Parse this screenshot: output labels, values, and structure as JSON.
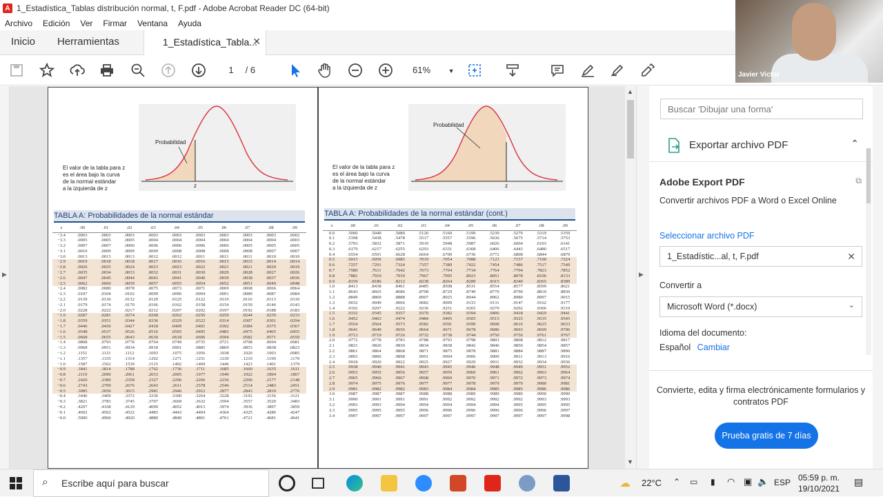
{
  "window": {
    "title": "1_Estadística_Tablas distribución normal, t, F.pdf - Adobe Acrobat Reader DC (64-bit)"
  },
  "menu": [
    "Archivo",
    "Edición",
    "Ver",
    "Firmar",
    "Ventana",
    "Ayuda"
  ],
  "tabs": {
    "home": "Inicio",
    "tools": "Herramientas",
    "document": "1_Estadística_Tabla..."
  },
  "toolbar": {
    "page_current": "1",
    "page_total": "/ 6",
    "zoom": "61%"
  },
  "pdf": {
    "left": {
      "fig_label": "Probabilidad",
      "caption": [
        "El valor de la tabla para z",
        "es el área bajo la curva",
        "de la normal estándar",
        "a la izquierda de z"
      ],
      "axis_mark": "z",
      "table_title": "TABLA  A:  Probabilidades de la normal estándar",
      "col_z": "z",
      "cols": [
        ".00",
        ".01",
        ".02",
        ".03",
        ".04",
        ".05",
        ".06",
        ".07",
        ".08",
        ".09"
      ],
      "rows": [
        [
          "−3.4",
          ".0003",
          ".0003",
          ".0003",
          ".0003",
          ".0003",
          ".0003",
          ".0003",
          ".0003",
          ".0003",
          ".0002"
        ],
        [
          "−3.3",
          ".0005",
          ".0005",
          ".0005",
          ".0004",
          ".0004",
          ".0004",
          ".0004",
          ".0004",
          ".0004",
          ".0003"
        ],
        [
          "−3.2",
          ".0007",
          ".0007",
          ".0006",
          ".0006",
          ".0006",
          ".0006",
          ".0006",
          ".0005",
          ".0005",
          ".0005"
        ],
        [
          "−3.1",
          ".0010",
          ".0009",
          ".0009",
          ".0009",
          ".0008",
          ".0008",
          ".0008",
          ".0008",
          ".0007",
          ".0007"
        ],
        [
          "−3.0",
          ".0013",
          ".0013",
          ".0013",
          ".0012",
          ".0012",
          ".0011",
          ".0011",
          ".0011",
          ".0010",
          ".0010"
        ],
        [
          "−2.9",
          ".0019",
          ".0018",
          ".0018",
          ".0017",
          ".0016",
          ".0016",
          ".0015",
          ".0015",
          ".0014",
          ".0014"
        ],
        [
          "−2.8",
          ".0026",
          ".0025",
          ".0024",
          ".0023",
          ".0023",
          ".0022",
          ".0021",
          ".0021",
          ".0020",
          ".0019"
        ],
        [
          "−2.7",
          ".0035",
          ".0034",
          ".0033",
          ".0032",
          ".0031",
          ".0030",
          ".0029",
          ".0028",
          ".0027",
          ".0026"
        ],
        [
          "−2.6",
          ".0047",
          ".0045",
          ".0044",
          ".0043",
          ".0041",
          ".0040",
          ".0039",
          ".0038",
          ".0037",
          ".0036"
        ],
        [
          "−2.5",
          ".0062",
          ".0060",
          ".0059",
          ".0057",
          ".0055",
          ".0054",
          ".0052",
          ".0051",
          ".0049",
          ".0048"
        ],
        [
          "−2.4",
          ".0082",
          ".0080",
          ".0078",
          ".0075",
          ".0073",
          ".0071",
          ".0069",
          ".0068",
          ".0066",
          ".0064"
        ],
        [
          "−2.3",
          ".0107",
          ".0104",
          ".0102",
          ".0099",
          ".0096",
          ".0094",
          ".0091",
          ".0089",
          ".0087",
          ".0084"
        ],
        [
          "−2.2",
          ".0139",
          ".0136",
          ".0132",
          ".0129",
          ".0125",
          ".0122",
          ".0119",
          ".0116",
          ".0113",
          ".0110"
        ],
        [
          "−2.1",
          ".0179",
          ".0174",
          ".0170",
          ".0166",
          ".0162",
          ".0158",
          ".0154",
          ".0150",
          ".0146",
          ".0143"
        ],
        [
          "−2.0",
          ".0228",
          ".0222",
          ".0217",
          ".0212",
          ".0207",
          ".0202",
          ".0197",
          ".0192",
          ".0188",
          ".0183"
        ],
        [
          "−1.9",
          ".0287",
          ".0281",
          ".0274",
          ".0268",
          ".0262",
          ".0256",
          ".0250",
          ".0244",
          ".0239",
          ".0233"
        ],
        [
          "−1.8",
          ".0359",
          ".0351",
          ".0344",
          ".0336",
          ".0329",
          ".0322",
          ".0314",
          ".0307",
          ".0301",
          ".0294"
        ],
        [
          "−1.7",
          ".0446",
          ".0436",
          ".0427",
          ".0418",
          ".0409",
          ".0401",
          ".0392",
          ".0384",
          ".0375",
          ".0367"
        ],
        [
          "−1.6",
          ".0548",
          ".0537",
          ".0526",
          ".0516",
          ".0505",
          ".0495",
          ".0485",
          ".0475",
          ".0465",
          ".0455"
        ],
        [
          "−1.5",
          ".0668",
          ".0655",
          ".0643",
          ".0630",
          ".0618",
          ".0606",
          ".0594",
          ".0582",
          ".0571",
          ".0559"
        ],
        [
          "−1.4",
          ".0808",
          ".0793",
          ".0778",
          ".0764",
          ".0749",
          ".0735",
          ".0721",
          ".0708",
          ".0694",
          ".0681"
        ],
        [
          "−1.3",
          ".0968",
          ".0951",
          ".0934",
          ".0918",
          ".0901",
          ".0885",
          ".0869",
          ".0853",
          ".0838",
          ".0823"
        ],
        [
          "−1.2",
          ".1151",
          ".1131",
          ".1112",
          ".1093",
          ".1075",
          ".1056",
          ".1038",
          ".1020",
          ".1003",
          ".0985"
        ],
        [
          "−1.1",
          ".1357",
          ".1335",
          ".1314",
          ".1292",
          ".1271",
          ".1251",
          ".1230",
          ".1210",
          ".1190",
          ".1170"
        ],
        [
          "−1.0",
          ".1587",
          ".1562",
          ".1539",
          ".1515",
          ".1492",
          ".1469",
          ".1446",
          ".1423",
          ".1401",
          ".1379"
        ],
        [
          "−0.9",
          ".1841",
          ".1814",
          ".1788",
          ".1762",
          ".1736",
          ".1711",
          ".1685",
          ".1660",
          ".1635",
          ".1611"
        ],
        [
          "−0.8",
          ".2119",
          ".2090",
          ".2061",
          ".2033",
          ".2005",
          ".1977",
          ".1949",
          ".1922",
          ".1894",
          ".1867"
        ],
        [
          "−0.7",
          ".2420",
          ".2389",
          ".2358",
          ".2327",
          ".2296",
          ".2266",
          ".2236",
          ".2206",
          ".2177",
          ".2148"
        ],
        [
          "−0.6",
          ".2743",
          ".2709",
          ".2676",
          ".2643",
          ".2611",
          ".2578",
          ".2546",
          ".2514",
          ".2483",
          ".2451"
        ],
        [
          "−0.5",
          ".3085",
          ".3050",
          ".3015",
          ".2981",
          ".2946",
          ".2912",
          ".2877",
          ".2843",
          ".2810",
          ".2776"
        ],
        [
          "−0.4",
          ".3446",
          ".3409",
          ".3372",
          ".3336",
          ".3300",
          ".3264",
          ".3228",
          ".3192",
          ".3156",
          ".3121"
        ],
        [
          "−0.3",
          ".3821",
          ".3783",
          ".3745",
          ".3707",
          ".3669",
          ".3632",
          ".3594",
          ".3557",
          ".3520",
          ".3483"
        ],
        [
          "−0.2",
          ".4207",
          ".4168",
          ".4129",
          ".4090",
          ".4052",
          ".4013",
          ".3974",
          ".3936",
          ".3897",
          ".3859"
        ],
        [
          "−0.1",
          ".4602",
          ".4562",
          ".4522",
          ".4483",
          ".4443",
          ".4404",
          ".4364",
          ".4325",
          ".4286",
          ".4247"
        ],
        [
          "−0.0",
          ".5000",
          ".4960",
          ".4920",
          ".4880",
          ".4840",
          ".4801",
          ".4761",
          ".4721",
          ".4681",
          ".4641"
        ]
      ]
    },
    "right": {
      "fig_label": "Probabilidad",
      "caption": [
        "El valor de la tabla para z",
        "es el área bajo la curva",
        "de la normal estándar",
        "a la izquierda de z"
      ],
      "axis_mark": "z",
      "table_title": "TABLA A: Probabilidades de la normal estándar (cont.)",
      "col_z": "z",
      "cols": [
        ".00",
        ".01",
        ".02",
        ".03",
        ".04",
        ".05",
        ".06",
        ".07",
        ".08",
        ".09"
      ],
      "rows": [
        [
          "0.0",
          ".5000",
          ".5040",
          ".5080",
          ".5120",
          ".5160",
          ".5199",
          ".5239",
          ".5279",
          ".5319",
          ".5359"
        ],
        [
          "0.1",
          ".5398",
          ".5438",
          ".5478",
          ".5517",
          ".5557",
          ".5596",
          ".5636",
          ".5675",
          ".5714",
          ".5753"
        ],
        [
          "0.2",
          ".5793",
          ".5832",
          ".5871",
          ".5910",
          ".5948",
          ".5987",
          ".6026",
          ".6064",
          ".6103",
          ".6141"
        ],
        [
          "0.3",
          ".6179",
          ".6217",
          ".6255",
          ".6293",
          ".6331",
          ".6368",
          ".6406",
          ".6443",
          ".6480",
          ".6517"
        ],
        [
          "0.4",
          ".6554",
          ".6591",
          ".6628",
          ".6664",
          ".6700",
          ".6736",
          ".6772",
          ".6808",
          ".6844",
          ".6879"
        ],
        [
          "0.5",
          ".6915",
          ".6950",
          ".6985",
          ".7019",
          ".7054",
          ".7088",
          ".7123",
          ".7157",
          ".7190",
          ".7224"
        ],
        [
          "0.6",
          ".7257",
          ".7291",
          ".7324",
          ".7357",
          ".7389",
          ".7422",
          ".7454",
          ".7486",
          ".7517",
          ".7549"
        ],
        [
          "0.7",
          ".7580",
          ".7611",
          ".7642",
          ".7673",
          ".7704",
          ".7734",
          ".7764",
          ".7794",
          ".7823",
          ".7852"
        ],
        [
          "0.8",
          ".7881",
          ".7910",
          ".7939",
          ".7967",
          ".7995",
          ".8023",
          ".8051",
          ".8078",
          ".8106",
          ".8133"
        ],
        [
          "0.9",
          ".8159",
          ".8186",
          ".8212",
          ".8238",
          ".8264",
          ".8289",
          ".8315",
          ".8340",
          ".8365",
          ".8389"
        ],
        [
          "1.0",
          ".8413",
          ".8438",
          ".8461",
          ".8485",
          ".8508",
          ".8531",
          ".8554",
          ".8577",
          ".8599",
          ".8621"
        ],
        [
          "1.1",
          ".8643",
          ".8665",
          ".8686",
          ".8708",
          ".8729",
          ".8749",
          ".8770",
          ".8790",
          ".8810",
          ".8830"
        ],
        [
          "1.2",
          ".8849",
          ".8869",
          ".8888",
          ".8907",
          ".8925",
          ".8944",
          ".8962",
          ".8980",
          ".8997",
          ".9015"
        ],
        [
          "1.3",
          ".9032",
          ".9049",
          ".9066",
          ".9082",
          ".9099",
          ".9115",
          ".9131",
          ".9147",
          ".9162",
          ".9177"
        ],
        [
          "1.4",
          ".9192",
          ".9207",
          ".9222",
          ".9236",
          ".9251",
          ".9265",
          ".9279",
          ".9292",
          ".9306",
          ".9319"
        ],
        [
          "1.5",
          ".9332",
          ".9345",
          ".9357",
          ".9370",
          ".9382",
          ".9394",
          ".9406",
          ".9418",
          ".9429",
          ".9441"
        ],
        [
          "1.6",
          ".9452",
          ".9463",
          ".9474",
          ".9484",
          ".9495",
          ".9505",
          ".9515",
          ".9525",
          ".9535",
          ".9545"
        ],
        [
          "1.7",
          ".9554",
          ".9564",
          ".9573",
          ".9582",
          ".9591",
          ".9599",
          ".9608",
          ".9616",
          ".9625",
          ".9633"
        ],
        [
          "1.8",
          ".9641",
          ".9649",
          ".9656",
          ".9664",
          ".9671",
          ".9678",
          ".9686",
          ".9693",
          ".9699",
          ".9706"
        ],
        [
          "1.9",
          ".9713",
          ".9719",
          ".9726",
          ".9732",
          ".9738",
          ".9744",
          ".9750",
          ".9756",
          ".9761",
          ".9767"
        ],
        [
          "2.0",
          ".9772",
          ".9778",
          ".9783",
          ".9788",
          ".9793",
          ".9798",
          ".9803",
          ".9808",
          ".9812",
          ".9817"
        ],
        [
          "2.1",
          ".9821",
          ".9826",
          ".9830",
          ".9834",
          ".9838",
          ".9842",
          ".9846",
          ".9850",
          ".9854",
          ".9857"
        ],
        [
          "2.2",
          ".9861",
          ".9864",
          ".9868",
          ".9871",
          ".9875",
          ".9878",
          ".9881",
          ".9884",
          ".9887",
          ".9890"
        ],
        [
          "2.3",
          ".9893",
          ".9896",
          ".9898",
          ".9901",
          ".9904",
          ".9906",
          ".9909",
          ".9911",
          ".9913",
          ".9916"
        ],
        [
          "2.4",
          ".9918",
          ".9920",
          ".9922",
          ".9925",
          ".9927",
          ".9929",
          ".9931",
          ".9932",
          ".9934",
          ".9936"
        ],
        [
          "2.5",
          ".9938",
          ".9940",
          ".9941",
          ".9943",
          ".9945",
          ".9946",
          ".9948",
          ".9949",
          ".9951",
          ".9952"
        ],
        [
          "2.6",
          ".9953",
          ".9955",
          ".9956",
          ".9957",
          ".9959",
          ".9960",
          ".9961",
          ".9962",
          ".9963",
          ".9964"
        ],
        [
          "2.7",
          ".9965",
          ".9966",
          ".9967",
          ".9968",
          ".9969",
          ".9970",
          ".9971",
          ".9972",
          ".9973",
          ".9974"
        ],
        [
          "2.8",
          ".9974",
          ".9975",
          ".9976",
          ".9977",
          ".9977",
          ".9978",
          ".9979",
          ".9979",
          ".9980",
          ".9981"
        ],
        [
          "2.9",
          ".9981",
          ".9982",
          ".9982",
          ".9983",
          ".9984",
          ".9984",
          ".9985",
          ".9985",
          ".9986",
          ".9986"
        ],
        [
          "3.0",
          ".9987",
          ".9987",
          ".9987",
          ".9988",
          ".9988",
          ".9989",
          ".9989",
          ".9989",
          ".9990",
          ".9990"
        ],
        [
          "3.1",
          ".9990",
          ".9991",
          ".9991",
          ".9991",
          ".9992",
          ".9992",
          ".9992",
          ".9992",
          ".9993",
          ".9993"
        ],
        [
          "3.2",
          ".9993",
          ".9993",
          ".9994",
          ".9994",
          ".9994",
          ".9994",
          ".9994",
          ".9995",
          ".9995",
          ".9995"
        ],
        [
          "3.3",
          ".9995",
          ".9995",
          ".9995",
          ".9996",
          ".9996",
          ".9996",
          ".9996",
          ".9996",
          ".9996",
          ".9997"
        ],
        [
          "3.4",
          ".9997",
          ".9997",
          ".9997",
          ".9997",
          ".9997",
          ".9997",
          ".9997",
          ".9997",
          ".9997",
          ".9998"
        ]
      ]
    }
  },
  "panel": {
    "search_placeholder": "Buscar 'Dibujar una forma'",
    "export_title": "Exportar archivo PDF",
    "adobe_export": "Adobe Export PDF",
    "adobe_desc": "Convertir archivos PDF a Word o Excel Online",
    "select_label": "Seleccionar archivo PDF",
    "file_value": "1_Estadístic...al, t, F.pdf",
    "convert_label": "Convertir a",
    "convert_value": "Microsoft Word (*.docx)",
    "lang_label": "Idioma del documento:",
    "lang_value": "Español",
    "lang_change": "Cambiar",
    "promo": "Convierte, edita y firma electrónicamente formularios y contratos PDF",
    "trial_button": "Prueba gratis de 7 días"
  },
  "webcam": {
    "name": "Javier Victor"
  },
  "taskbar": {
    "search": "Escribe aquí para buscar",
    "temp": "22°C",
    "lang": "ESP",
    "time": "05:59 p. m.",
    "date": "19/10/2021"
  },
  "colors": {
    "accent": "#1473e6",
    "acrobat_red": "#e0251b",
    "table_band": "#f3e3d3",
    "curve": "#d9333f"
  }
}
